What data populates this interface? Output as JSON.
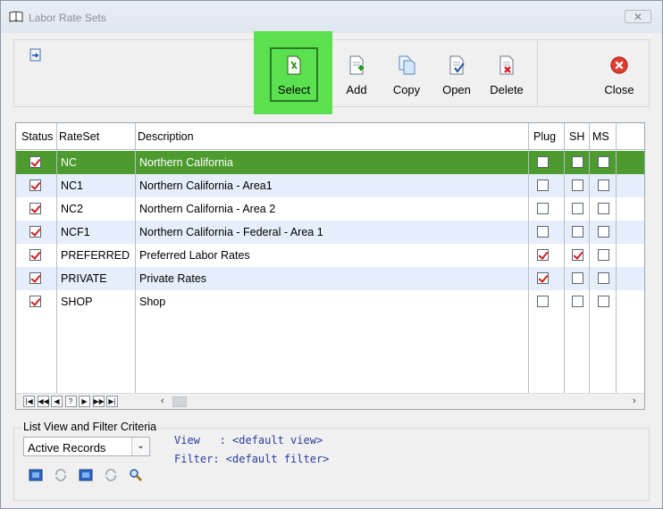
{
  "window": {
    "title": "Labor Rate Sets",
    "close_glyph": "✕"
  },
  "toolbar": {
    "buttons": [
      {
        "id": "select",
        "label": "Select",
        "icon": "select-icon"
      },
      {
        "id": "add",
        "label": "Add",
        "icon": "add-icon"
      },
      {
        "id": "copy",
        "label": "Copy",
        "icon": "copy-icon"
      },
      {
        "id": "open",
        "label": "Open",
        "icon": "open-icon"
      },
      {
        "id": "delete",
        "label": "Delete",
        "icon": "delete-icon"
      },
      {
        "id": "close",
        "label": "Close",
        "icon": "close-icon"
      }
    ],
    "highlight_color": "#5be04f"
  },
  "grid": {
    "columns": [
      "Status",
      "RateSet",
      "Description",
      "Plug",
      "SH",
      "MS"
    ],
    "rows": [
      {
        "status": true,
        "rateset": "NC",
        "description": "Northern California",
        "plug": false,
        "sh": false,
        "ms": false,
        "selected": true
      },
      {
        "status": true,
        "rateset": "NC1",
        "description": "Northern California - Area1",
        "plug": false,
        "sh": false,
        "ms": false
      },
      {
        "status": true,
        "rateset": "NC2",
        "description": "Northern California - Area 2",
        "plug": false,
        "sh": false,
        "ms": false
      },
      {
        "status": true,
        "rateset": "NCF1",
        "description": "Northern California - Federal - Area 1",
        "plug": false,
        "sh": false,
        "ms": false
      },
      {
        "status": true,
        "rateset": "PREFERRED",
        "description": "Preferred Labor Rates",
        "plug": true,
        "sh": true,
        "ms": false
      },
      {
        "status": true,
        "rateset": "PRIVATE",
        "description": "Private Rates",
        "plug": true,
        "sh": false,
        "ms": false
      },
      {
        "status": true,
        "rateset": "SHOP",
        "description": "Shop",
        "plug": false,
        "sh": false,
        "ms": false
      }
    ],
    "nav_buttons": [
      "|◀",
      "◀◀",
      "◀",
      "?",
      "▶",
      "▶▶",
      "▶|"
    ],
    "selected_row_color": "#4d9a2f",
    "alt_row_color": "#e5eefa"
  },
  "filter": {
    "title": "List View and Filter Criteria",
    "dropdown_value": "Active Records",
    "view_line": "View   : <default view>",
    "filter_line": "Filter: <default filter>"
  }
}
